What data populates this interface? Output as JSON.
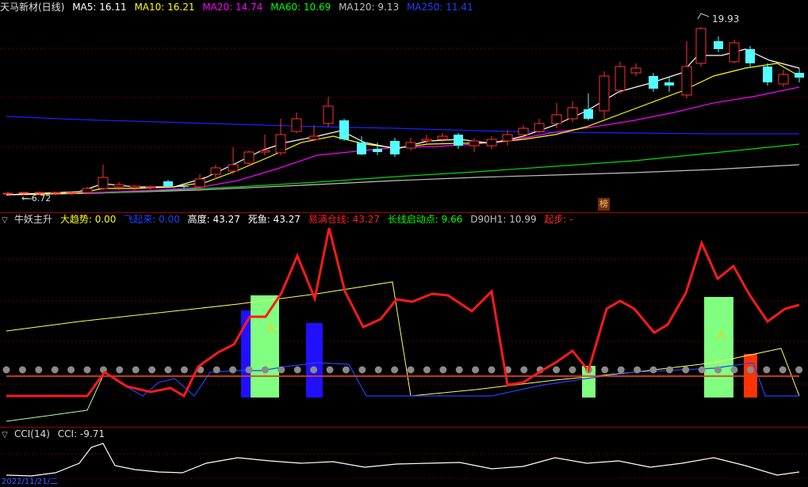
{
  "panel_top": {
    "stock_title": "天马新材(日线)",
    "ma5": "MA5: 16.11",
    "ma10": "MA10: 16.21",
    "ma20": "MA20: 14.74",
    "ma60": "MA60: 10.69",
    "ma120": "MA120: 9.13",
    "ma250": "MA250: 11.41",
    "high_label": "19.93",
    "low_label": "6.72",
    "badge": "榜"
  },
  "panel_mid": {
    "title": "牛妖主升",
    "big_trend": "大趋势: 0.00",
    "take_off": "飞起来: 0.00",
    "height": "高度: 43.27",
    "dead_fish": "死鱼: 43.27",
    "full_position": "易满仓线: 43.27",
    "long_start": "长线启动点: 9.66",
    "d90h1": "D90H1: 10.99",
    "start_step": "起步: -"
  },
  "panel_bottom": {
    "title": "CCI(14)",
    "cci_value": "CCI: -9.71",
    "date_label": "2022/11/21/二"
  },
  "colors": {
    "up": "#ff3232",
    "down": "#54ffff",
    "ma5": "#ffffff",
    "ma10": "#ffff00",
    "ma20": "#ff00ff",
    "ma60": "#00ff00",
    "ma120": "#c0c0c0",
    "ma250": "#0000ff"
  }
}
